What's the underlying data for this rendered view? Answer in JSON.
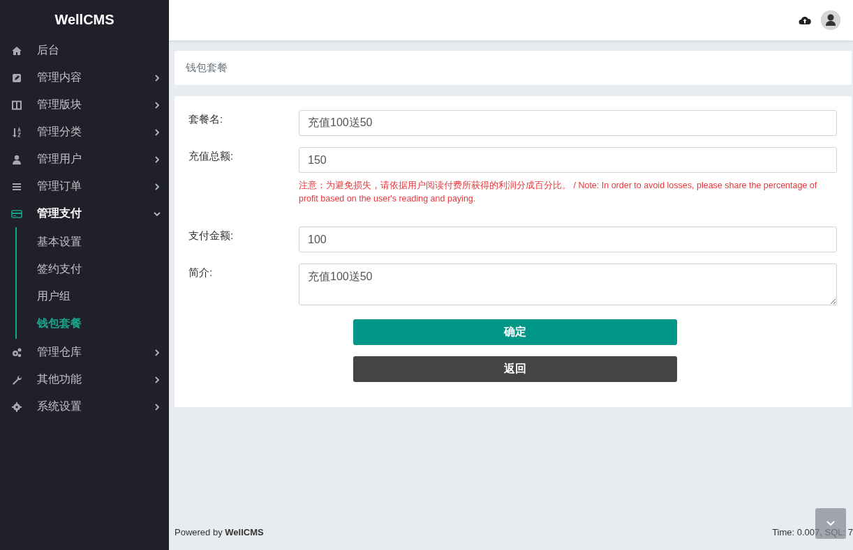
{
  "brand": "WellCMS",
  "sidebar": {
    "items": [
      {
        "label": "后台",
        "selected": false
      },
      {
        "label": "管理内容",
        "selected": false,
        "expanded": false
      },
      {
        "label": "管理版块",
        "selected": false,
        "expanded": false
      },
      {
        "label": "管理分类",
        "selected": false,
        "expanded": false
      },
      {
        "label": "管理用户",
        "selected": false,
        "expanded": false
      },
      {
        "label": "管理订单",
        "selected": false,
        "expanded": false
      },
      {
        "label": "管理支付",
        "selected": true,
        "expanded": true,
        "children": [
          {
            "label": "基本设置",
            "selected": false
          },
          {
            "label": "签约支付",
            "selected": false
          },
          {
            "label": "用户组",
            "selected": false
          },
          {
            "label": "钱包套餐",
            "selected": true
          }
        ]
      },
      {
        "label": "管理仓库",
        "selected": false,
        "expanded": false
      },
      {
        "label": "其他功能",
        "selected": false,
        "expanded": false
      },
      {
        "label": "系统设置",
        "selected": false,
        "expanded": false
      }
    ]
  },
  "breadcrumb": "钱包套餐",
  "form": {
    "fields": [
      {
        "kind": "input",
        "label": "套餐名:",
        "value": "充值100送50"
      },
      {
        "kind": "input",
        "label": "充值总额:",
        "value": "150",
        "note": "注意：为避免损失，请依据用户阅读付费所获得的利润分成百分比。 / Note: In order to avoid losses, please share the percentage of profit based on the user's reading and paying."
      },
      {
        "kind": "input",
        "label": "支付金额:",
        "value": "100"
      },
      {
        "kind": "textarea",
        "label": "简介:",
        "value": "充值100送50"
      }
    ],
    "buttons": [
      {
        "kind": "primary",
        "label": "确定"
      },
      {
        "kind": "secondary",
        "label": "返回"
      }
    ]
  },
  "footer": {
    "powered_prefix": "Powered by",
    "powered_name": "WellCMS",
    "stats": "Time: 0.007, SQL: 7"
  }
}
